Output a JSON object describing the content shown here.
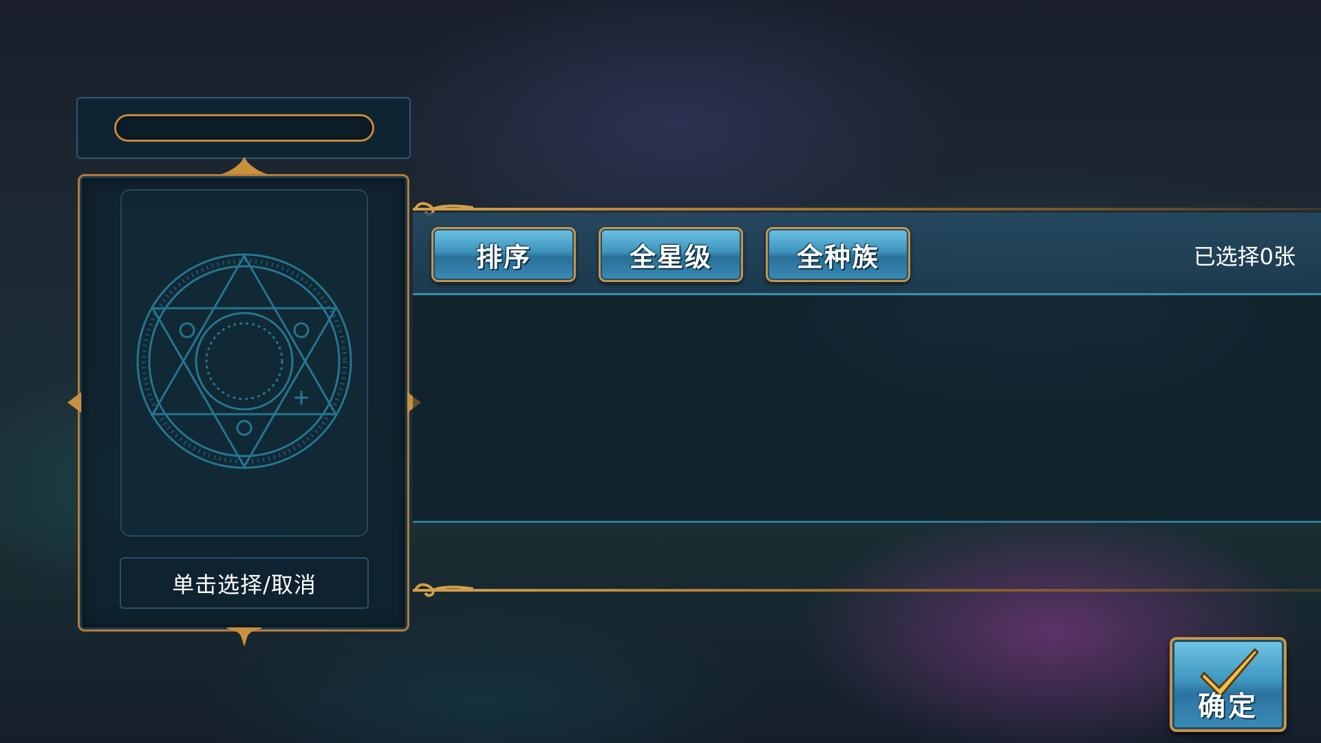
{
  "name_plate": {
    "name": ""
  },
  "card_panel": {
    "hint": "单击选择/取消",
    "placeholder_icon": "magic-circle-icon"
  },
  "toolbar": {
    "buttons": [
      {
        "label": "排序"
      },
      {
        "label": "全星级"
      },
      {
        "label": "全种族"
      }
    ],
    "selected_count": "已选择0张"
  },
  "confirm": {
    "label": "确定",
    "icon": "checkmark-icon"
  },
  "colors": {
    "gold": "#c79447",
    "button_blue": "#3d93bd",
    "panel_dark": "#0e2230"
  }
}
